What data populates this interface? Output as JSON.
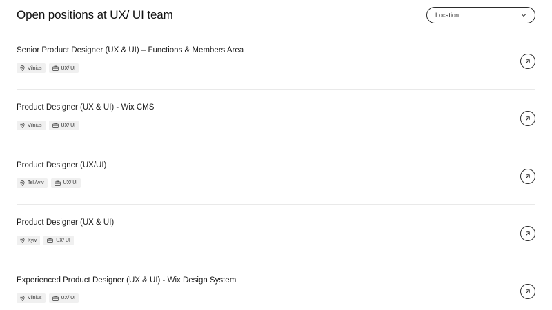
{
  "header": {
    "title": "Open positions at UX/ UI team",
    "location_filter": {
      "selected": "Location"
    }
  },
  "jobs": [
    {
      "title": "Senior Product Designer (UX & UI) – Functions & Members Area",
      "location": "Vilnius",
      "team": "UX/ UI"
    },
    {
      "title": "Product Designer (UX & UI) - Wix CMS",
      "location": "Vilnius",
      "team": "UX/ UI"
    },
    {
      "title": "Product Designer (UX/UI)",
      "location": "Tel Aviv",
      "team": "UX/ UI"
    },
    {
      "title": "Product Designer (UX & UI)",
      "location": "Kyiv",
      "team": "UX/ UI"
    },
    {
      "title": "Experienced Product Designer (UX & UI) - Wix Design System",
      "location": "Vilnius",
      "team": "UX/ UI"
    }
  ],
  "icons": {
    "location": "location-pin-icon",
    "team": "briefcase-icon",
    "open": "arrow-up-right-icon",
    "dropdown": "chevron-down-icon"
  },
  "colors": {
    "text": "#1a1a1a",
    "border": "#2b2b2b",
    "tag_bg": "#f0f0f0",
    "divider": "#e9e9e9"
  }
}
